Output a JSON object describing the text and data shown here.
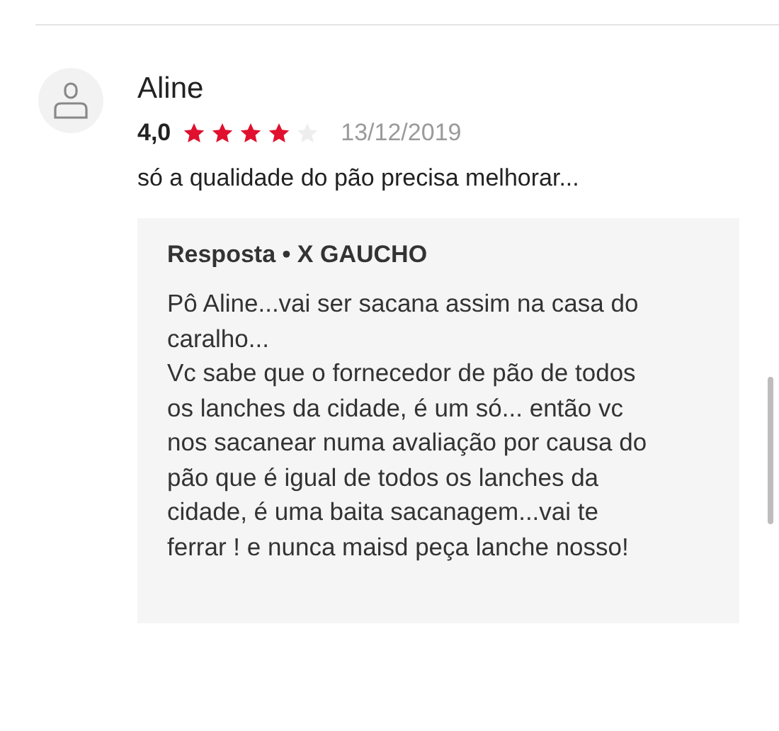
{
  "review": {
    "author": "Aline",
    "rating": "4,0",
    "stars": 4,
    "date": "13/12/2019",
    "comment": "só a qualidade do pão precisa melhorar...",
    "reply": {
      "title": "Resposta • X GAUCHO",
      "body": "Pô Aline...vai ser sacana assim na casa do caralho...\nVc sabe que o fornecedor de pão de todos os lanches da cidade, é um só... então vc nos sacanear numa avaliação por causa do pão que é igual de todos os lanches da cidade, é uma baita sacanagem...vai te ferrar ! e nunca maisd peça lanche nosso!"
    }
  }
}
